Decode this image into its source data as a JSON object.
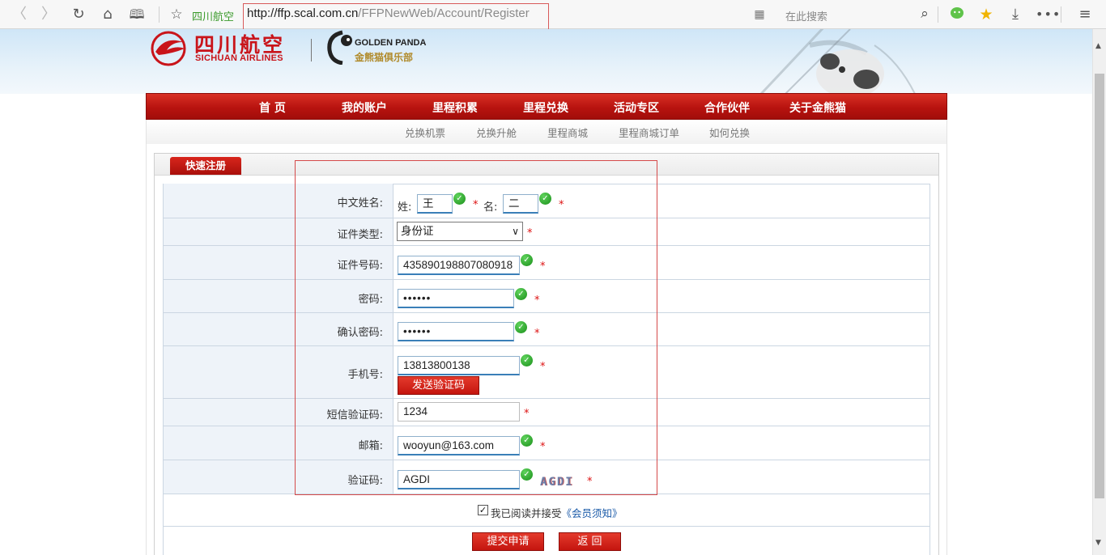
{
  "browser": {
    "site_name": "四川航空",
    "url_host": "http://ffp.scal.com.cn",
    "url_path": "/FFPNewWeb/Account/Register",
    "search_placeholder": "在此搜索",
    "icons": [
      "back-icon",
      "forward-icon",
      "reload-icon",
      "home-icon",
      "reader-icon",
      "bookmark-star-icon",
      "qr-icon",
      "search-icon",
      "wechat-icon",
      "favorites-icon",
      "download-icon",
      "more-icon",
      "menu-icon"
    ]
  },
  "brand": {
    "sichuan_cn": "四川航空",
    "sichuan_en": "SICHUAN AIRLINES",
    "panda_en": "GOLDEN PANDA",
    "panda_cn": "金熊猫俱乐部"
  },
  "nav": {
    "items": [
      "首 页",
      "我的账户",
      "里程积累",
      "里程兑换",
      "活动专区",
      "合作伙伴",
      "关于金熊猫"
    ],
    "sub_items": [
      "兑换机票",
      "兑换升舱",
      "里程商城",
      "里程商城订单",
      "如何兑换"
    ]
  },
  "panel": {
    "tab_label": "快速注册"
  },
  "form": {
    "name_label": "中文姓名:",
    "surname_label": "姓:",
    "surname_value": "王",
    "given_label": "名:",
    "given_value": "二",
    "id_type_label": "证件类型:",
    "id_type_value": "身份证",
    "id_number_label": "证件号码:",
    "id_number_value": "435890198807080918",
    "password_label": "密码:",
    "password_value": "••••••",
    "confirm_label": "确认密码:",
    "confirm_value": "••••••",
    "mobile_label": "手机号:",
    "mobile_value": "13813800138",
    "send_code_label": "发送验证码",
    "sms_label": "短信验证码:",
    "sms_value": "1234",
    "email_label": "邮箱:",
    "email_value": "wooyun@163.com",
    "captcha_label": "验证码:",
    "captcha_value": "AGDI",
    "captcha_image_text": "AGDI",
    "required_mark": "*",
    "agree_text": "我已阅读并接受",
    "agree_link": "《会员须知》",
    "submit_label": "提交申请",
    "back_label": "返 回"
  },
  "colors": {
    "brand_red": "#c9141a",
    "valid_green": "#1a8f1a",
    "link_blue": "#1a5aa8"
  }
}
